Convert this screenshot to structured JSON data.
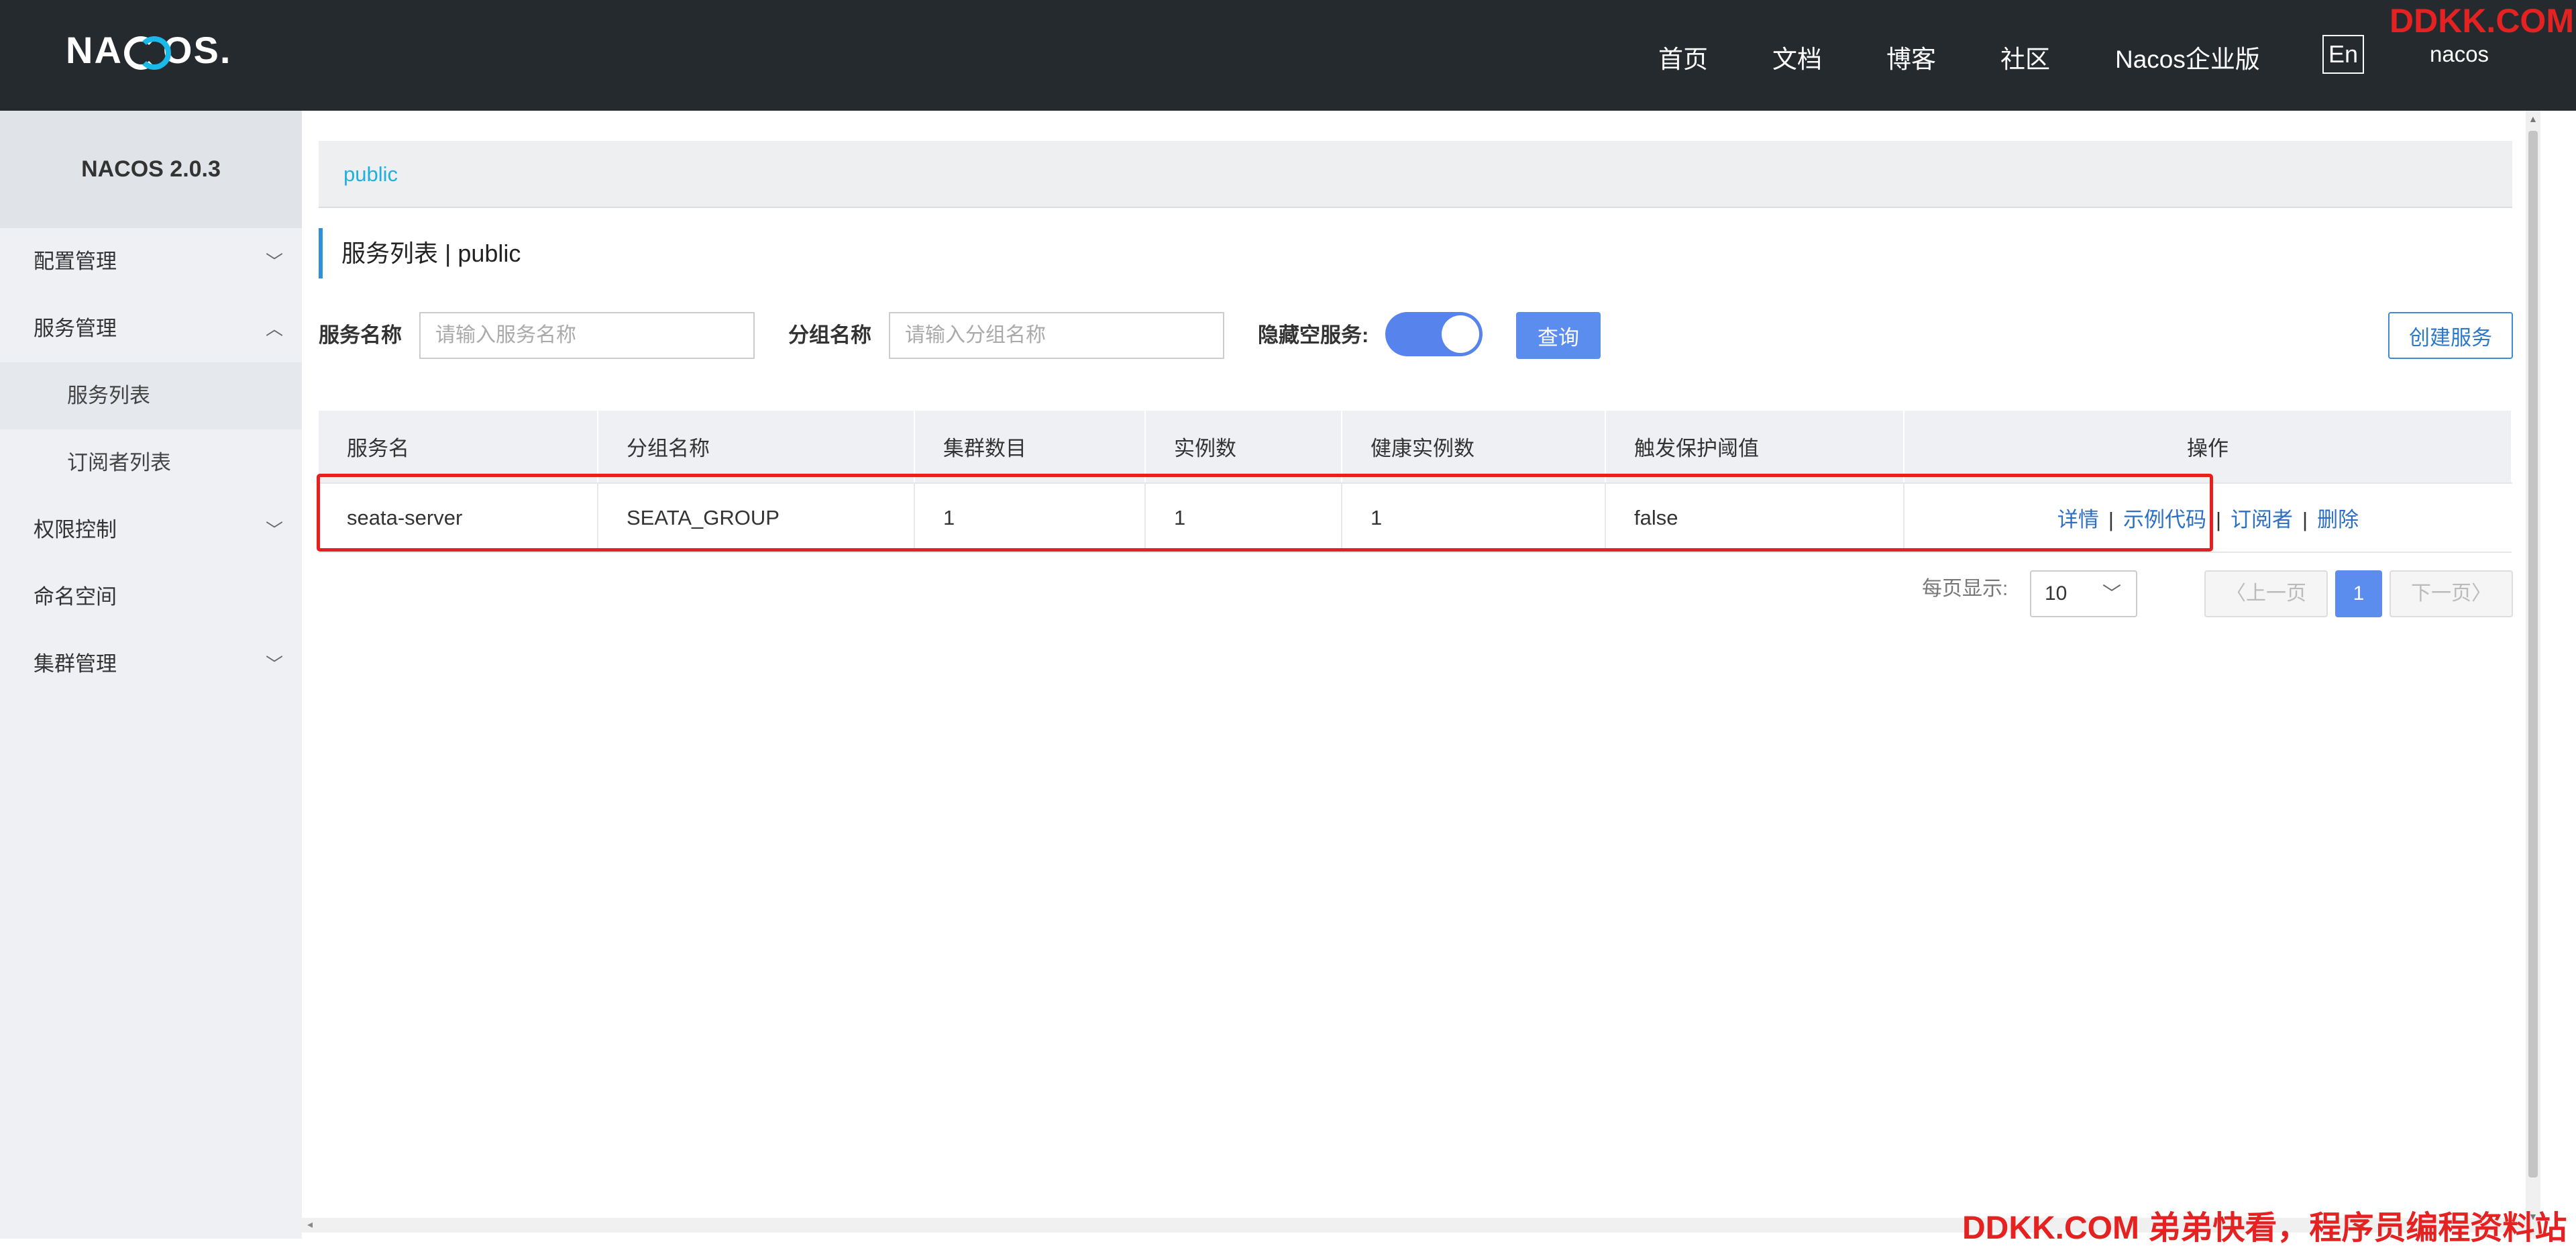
{
  "header": {
    "logo_text_1": "NA",
    "logo_text_2": "OS",
    "logo_dot": ".",
    "nav": [
      "首页",
      "文档",
      "博客",
      "社区",
      "Nacos企业版"
    ],
    "lang": "En",
    "user": "nacos",
    "watermark": "DDKK.COM"
  },
  "sidebar": {
    "title": "NACOS 2.0.3",
    "items": [
      {
        "label": "配置管理",
        "chevron": "⌵"
      },
      {
        "label": "服务管理",
        "chevron": "^"
      },
      {
        "label": "服务列表"
      },
      {
        "label": "订阅者列表"
      },
      {
        "label": "权限控制",
        "chevron": "⌵"
      },
      {
        "label": "命名空间"
      },
      {
        "label": "集群管理",
        "chevron": "⌵"
      }
    ]
  },
  "main": {
    "namespace": "public",
    "title": "服务列表  |  public",
    "filters": {
      "service_label": "服务名称",
      "service_placeholder": "请输入服务名称",
      "group_label": "分组名称",
      "group_placeholder": "请输入分组名称",
      "hide_empty_label": "隐藏空服务:",
      "query_button": "查询",
      "create_button": "创建服务"
    },
    "table": {
      "headers": [
        "服务名",
        "分组名称",
        "集群数目",
        "实例数",
        "健康实例数",
        "触发保护阈值",
        "操作"
      ],
      "rows": [
        {
          "name": "seata-server",
          "group": "SEATA_GROUP",
          "clusters": "1",
          "instances": "1",
          "healthy": "1",
          "threshold": "false",
          "ops": [
            "详情",
            "示例代码",
            "订阅者",
            "删除"
          ]
        }
      ]
    },
    "pagination": {
      "page_size_label": "每页显示:",
      "page_size": "10",
      "prev": "上一页",
      "current": "1",
      "next": "下一页"
    }
  },
  "watermark_bottom": "DDKK.COM 弟弟快看，程序员编程资料站",
  "colors": {
    "header_bg": "#252a2f",
    "accent": "#5b8def",
    "link": "#2c6fc4",
    "highlight": "#e61f1f"
  }
}
